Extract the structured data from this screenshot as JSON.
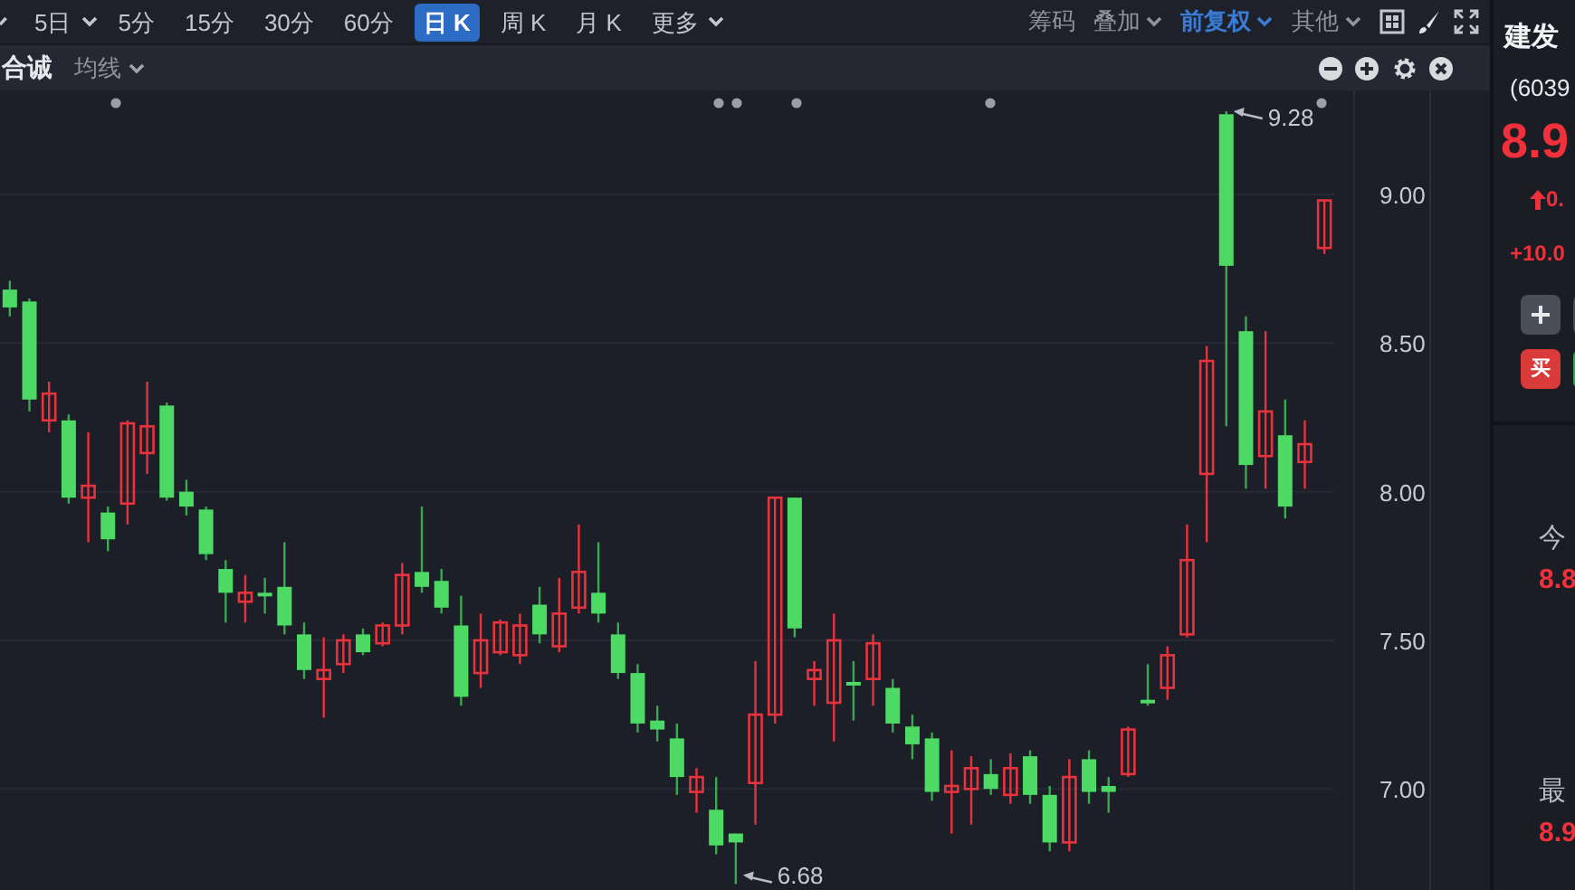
{
  "toolbar": {
    "periods": [
      {
        "label": "5日",
        "selected": false,
        "has_menu": true
      },
      {
        "label": "5分",
        "selected": false,
        "has_menu": false
      },
      {
        "label": "15分",
        "selected": false,
        "has_menu": false
      },
      {
        "label": "30分",
        "selected": false,
        "has_menu": false
      },
      {
        "label": "60分",
        "selected": false,
        "has_menu": false
      },
      {
        "label": "日 K",
        "selected": true,
        "has_menu": false
      },
      {
        "label": "周 K",
        "selected": false,
        "has_menu": false
      },
      {
        "label": "月 K",
        "selected": false,
        "has_menu": false
      },
      {
        "label": "更多",
        "selected": false,
        "has_menu": true
      }
    ],
    "options": [
      {
        "label": "筹码",
        "active": false,
        "has_menu": false
      },
      {
        "label": "叠加",
        "active": false,
        "has_menu": true
      },
      {
        "label": "前复权",
        "active": true,
        "has_menu": true
      },
      {
        "label": "其他",
        "active": false,
        "has_menu": true
      }
    ]
  },
  "chart_header": {
    "stock_name": "合诚",
    "indicator": "均线"
  },
  "chart": {
    "chart_data": {
      "type": "candlestick",
      "categories": [
        null,
        null,
        null,
        null,
        null,
        null,
        null,
        null,
        null,
        null,
        null,
        null,
        null,
        null,
        null,
        null,
        null,
        null,
        null,
        null,
        null,
        null,
        null,
        null,
        null,
        null,
        null,
        null,
        null,
        null,
        null,
        null,
        null,
        null,
        null,
        null,
        null,
        null,
        null,
        null,
        null,
        null,
        null,
        null,
        null,
        null,
        null,
        null,
        null,
        null,
        null,
        null,
        null,
        null,
        null,
        null,
        null,
        null,
        null,
        null,
        null,
        null,
        null,
        null,
        null,
        null,
        null,
        null
      ],
      "grid": true,
      "ylim": [
        6.66,
        9.35
      ],
      "yticks": [
        {
          "value": 9,
          "label": "9.00"
        },
        {
          "value": 8.5,
          "label": "8.50"
        },
        {
          "value": 8,
          "label": "8.00"
        },
        {
          "value": 7.5,
          "label": "7.50"
        },
        {
          "value": 7,
          "label": "7.00"
        }
      ],
      "ohlc": [
        [
          8.68,
          8.71,
          8.59,
          8.62
        ],
        [
          8.64,
          8.65,
          8.27,
          8.31
        ],
        [
          8.24,
          8.37,
          8.2,
          8.33
        ],
        [
          8.24,
          8.26,
          7.96,
          7.98
        ],
        [
          7.98,
          8.2,
          7.83,
          8.02
        ],
        [
          7.93,
          7.95,
          7.8,
          7.84
        ],
        [
          7.96,
          8.24,
          7.89,
          8.23
        ],
        [
          8.13,
          8.37,
          8.06,
          8.22
        ],
        [
          8.29,
          8.3,
          7.97,
          7.98
        ],
        [
          8.0,
          8.04,
          7.92,
          7.95
        ],
        [
          7.94,
          7.95,
          7.77,
          7.79
        ],
        [
          7.74,
          7.77,
          7.56,
          7.66
        ],
        [
          7.63,
          7.72,
          7.56,
          7.66
        ],
        [
          7.66,
          7.71,
          7.59,
          7.65
        ],
        [
          7.68,
          7.83,
          7.52,
          7.55
        ],
        [
          7.52,
          7.56,
          7.37,
          7.4
        ],
        [
          7.37,
          7.51,
          7.24,
          7.4
        ],
        [
          7.42,
          7.52,
          7.39,
          7.5
        ],
        [
          7.52,
          7.54,
          7.45,
          7.46
        ],
        [
          7.49,
          7.56,
          7.48,
          7.55
        ],
        [
          7.55,
          7.76,
          7.52,
          7.72
        ],
        [
          7.73,
          7.95,
          7.66,
          7.68
        ],
        [
          7.7,
          7.74,
          7.59,
          7.61
        ],
        [
          7.55,
          7.65,
          7.28,
          7.31
        ],
        [
          7.39,
          7.59,
          7.34,
          7.5
        ],
        [
          7.46,
          7.57,
          7.45,
          7.56
        ],
        [
          7.45,
          7.59,
          7.42,
          7.55
        ],
        [
          7.62,
          7.68,
          7.49,
          7.52
        ],
        [
          7.48,
          7.71,
          7.46,
          7.59
        ],
        [
          7.61,
          7.89,
          7.59,
          7.73
        ],
        [
          7.66,
          7.83,
          7.56,
          7.59
        ],
        [
          7.52,
          7.56,
          7.37,
          7.39
        ],
        [
          7.39,
          7.42,
          7.19,
          7.22
        ],
        [
          7.23,
          7.28,
          7.16,
          7.2
        ],
        [
          7.17,
          7.22,
          6.98,
          7.04
        ],
        [
          6.99,
          7.07,
          6.92,
          7.04
        ],
        [
          6.93,
          7.04,
          6.78,
          6.81
        ],
        [
          6.85,
          6.85,
          6.68,
          6.82
        ],
        [
          7.02,
          7.43,
          6.88,
          7.25
        ],
        [
          7.25,
          7.98,
          7.22,
          7.98
        ],
        [
          7.98,
          7.98,
          7.51,
          7.54
        ],
        [
          7.37,
          7.43,
          7.28,
          7.4
        ],
        [
          7.29,
          7.59,
          7.16,
          7.5
        ],
        [
          7.36,
          7.43,
          7.23,
          7.35
        ],
        [
          7.37,
          7.52,
          7.28,
          7.49
        ],
        [
          7.34,
          7.37,
          7.19,
          7.22
        ],
        [
          7.21,
          7.25,
          7.1,
          7.15
        ],
        [
          7.17,
          7.19,
          6.96,
          6.99
        ],
        [
          6.99,
          7.13,
          6.85,
          7.01
        ],
        [
          7.0,
          7.11,
          6.88,
          7.07
        ],
        [
          7.05,
          7.1,
          6.98,
          7.0
        ],
        [
          6.98,
          7.12,
          6.95,
          7.07
        ],
        [
          7.11,
          7.13,
          6.95,
          6.98
        ],
        [
          6.98,
          7.01,
          6.79,
          6.82
        ],
        [
          6.82,
          7.1,
          6.79,
          7.04
        ],
        [
          7.1,
          7.13,
          6.95,
          6.99
        ],
        [
          7.01,
          7.04,
          6.92,
          6.99
        ],
        [
          7.05,
          7.21,
          7.04,
          7.2
        ],
        [
          7.3,
          7.42,
          7.28,
          7.29
        ],
        [
          7.34,
          7.48,
          7.3,
          7.45
        ],
        [
          7.52,
          7.89,
          7.51,
          7.77
        ],
        [
          8.06,
          8.49,
          7.83,
          8.44
        ],
        [
          9.27,
          9.28,
          8.22,
          8.76
        ],
        [
          8.54,
          8.59,
          8.01,
          8.09
        ],
        [
          8.12,
          8.54,
          8.01,
          8.27
        ],
        [
          8.19,
          8.31,
          7.91,
          7.95
        ],
        [
          8.1,
          8.24,
          8.01,
          8.16
        ],
        [
          8.82,
          8.98,
          8.8,
          8.98
        ]
      ],
      "annotations": [
        "9.28",
        "6.68"
      ]
    }
  },
  "quote": {
    "name": "建发",
    "code": "(6039",
    "price": "8.9",
    "change": "0.",
    "change_percent": "+10.0",
    "buy_button": "买",
    "stats": [
      {
        "label": "今",
        "value": "8.8"
      },
      {
        "label": "最",
        "value": "8.9"
      }
    ]
  }
}
